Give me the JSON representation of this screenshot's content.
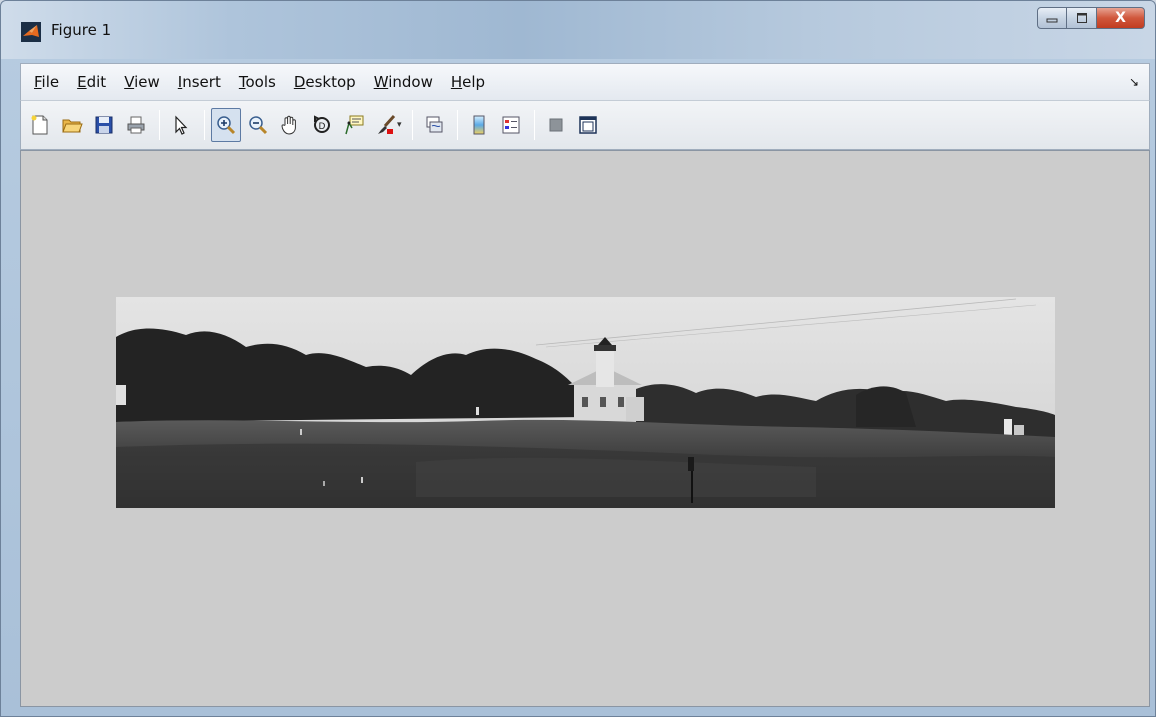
{
  "window": {
    "title": "Figure 1",
    "controls": {
      "minimize": "minimize",
      "maximize": "maximize",
      "close": "X"
    }
  },
  "menu": {
    "items": [
      {
        "label": "File",
        "mnemonic": "F",
        "rest": "ile"
      },
      {
        "label": "Edit",
        "mnemonic": "E",
        "rest": "dit"
      },
      {
        "label": "View",
        "mnemonic": "V",
        "rest": "iew"
      },
      {
        "label": "Insert",
        "mnemonic": "I",
        "rest": "nsert"
      },
      {
        "label": "Tools",
        "mnemonic": "T",
        "rest": "ools"
      },
      {
        "label": "Desktop",
        "mnemonic": "D",
        "rest": "esktop"
      },
      {
        "label": "Window",
        "mnemonic": "W",
        "rest": "indow"
      },
      {
        "label": "Help",
        "mnemonic": "H",
        "rest": "elp"
      }
    ],
    "dock_arrow": "↘"
  },
  "toolbar": {
    "buttons": [
      "new-figure-icon",
      "open-file-icon",
      "save-icon",
      "print-icon",
      "edit-plot-arrow-icon",
      "zoom-in-icon",
      "zoom-out-icon",
      "pan-hand-icon",
      "rotate-3d-icon",
      "data-cursor-icon",
      "brush-icon",
      "link-plot-icon",
      "colorbar-icon",
      "legend-icon",
      "hide-plot-tools-icon",
      "show-plot-tools-icon"
    ],
    "active": "zoom-in-icon"
  },
  "figure": {
    "background": "#cccccc",
    "image_content": "grayscale panorama"
  },
  "colors": {
    "close_button": "#c94a2e",
    "canvas": "#cccccc",
    "active_tool_border": "#5d7aa3"
  }
}
